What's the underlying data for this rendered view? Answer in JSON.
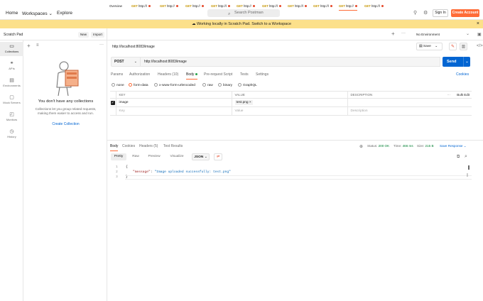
{
  "topbar": {
    "home": "Home",
    "workspaces": "Workspaces",
    "explore": "Explore",
    "search_placeholder": "Search Postman",
    "sign_in": "Sign In",
    "create_account": "Create Account"
  },
  "banner": {
    "text": "Working locally in Scratch Pad. Switch to a Workspace"
  },
  "sidebar": {
    "title": "Scratch Pad",
    "new_label": "New",
    "import_label": "Import",
    "rail": [
      {
        "label": "Collections",
        "icon": "collections-icon"
      },
      {
        "label": "APIs",
        "icon": "apis-icon"
      },
      {
        "label": "Environments",
        "icon": "environments-icon"
      },
      {
        "label": "Mock Servers",
        "icon": "mock-servers-icon"
      },
      {
        "label": "Monitors",
        "icon": "monitors-icon"
      },
      {
        "label": "History",
        "icon": "history-icon"
      }
    ],
    "empty_title": "You don't have any collections",
    "empty_desc_1": "Collections let you group related requests,",
    "empty_desc_2": "making them easier to access and run.",
    "create_collection": "Create Collection"
  },
  "tabs": {
    "overview": "Overview",
    "items": [
      {
        "method": "GET",
        "label": "http://l"
      },
      {
        "method": "GET",
        "label": "http://"
      },
      {
        "method": "GET",
        "label": "http://"
      },
      {
        "method": "GET",
        "label": "http://l"
      },
      {
        "method": "GET",
        "label": "http://"
      },
      {
        "method": "GET",
        "label": "http://l"
      },
      {
        "method": "GET",
        "label": "http://l"
      },
      {
        "method": "GET",
        "label": "http://l"
      },
      {
        "method": "GET",
        "label": "http://"
      },
      {
        "method": "GET",
        "label": "http://l"
      }
    ],
    "environment": "No Environment"
  },
  "request": {
    "title": "http://localhost:8083/image",
    "save": "Save",
    "method": "POST",
    "url": "http://localhost:8083/image",
    "send": "Send",
    "tabs": [
      "Params",
      "Authorization",
      "Headers (10)",
      "Body",
      "Pre-request Script",
      "Tests",
      "Settings"
    ],
    "cookies": "Cookies",
    "body_types": [
      "none",
      "form-data",
      "x-www-form-urlencoded",
      "raw",
      "binary",
      "GraphQL"
    ],
    "table": {
      "headers": [
        "KEY",
        "VALUE",
        "DESCRIPTION"
      ],
      "bulk_edit": "Bulk Edit",
      "rows": [
        {
          "key": "image",
          "value": "test.png",
          "description": ""
        }
      ],
      "placeholder": {
        "key": "Key",
        "value": "Value",
        "description": "Description"
      }
    }
  },
  "response": {
    "tabs": [
      "Body",
      "Cookies",
      "Headers (5)",
      "Test Results"
    ],
    "status_label": "Status:",
    "status": "200 OK",
    "time_label": "Time:",
    "time": "466 ms",
    "size_label": "Size:",
    "size": "215 B",
    "save_response": "Save Response",
    "format_tabs": [
      "Pretty",
      "Raw",
      "Preview",
      "Visualize"
    ],
    "format": "JSON",
    "code": {
      "lines": [
        "1",
        "2",
        "3"
      ],
      "l1": "{",
      "key": "\"message\"",
      "value": "\"Image uploaded successfully: test.png\"",
      "l3": "}"
    }
  }
}
